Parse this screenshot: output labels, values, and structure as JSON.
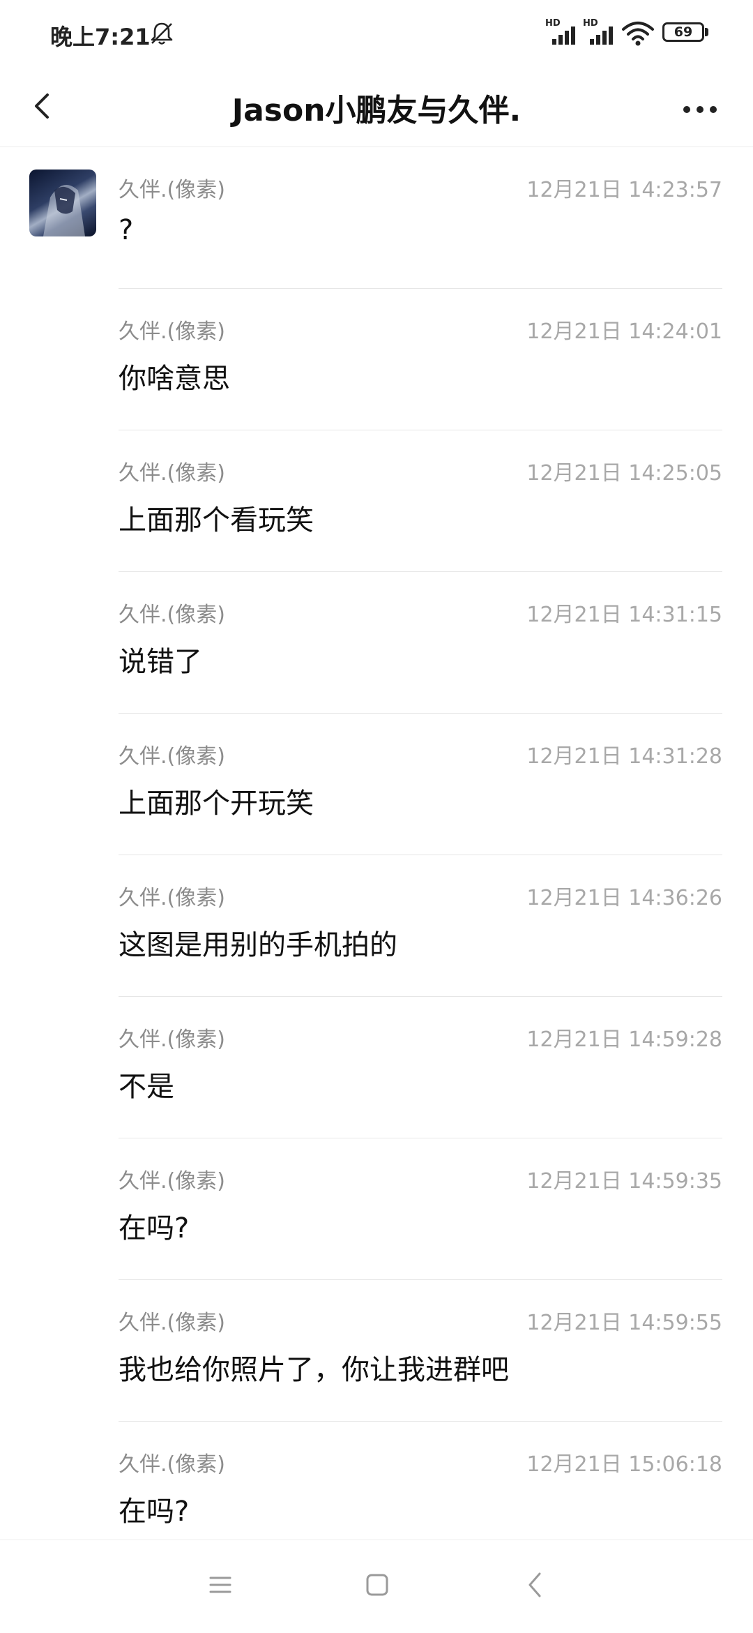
{
  "status_bar": {
    "time": "晚上7:21",
    "signal_1_label": "HD",
    "signal_2_label": "HD",
    "battery": "69",
    "icons": [
      "bell-muted-icon",
      "signal-icon",
      "signal-icon",
      "wifi-icon",
      "battery-icon"
    ]
  },
  "header": {
    "title": "Jason小鹏友与久伴.",
    "back_icon": "chevron-left-icon",
    "more_icon": "more-dots-icon"
  },
  "messages": [
    {
      "sender": "久伴.(像素)",
      "time": "12月21日 14:23:57",
      "text": "?"
    },
    {
      "sender": "久伴.(像素)",
      "time": "12月21日 14:24:01",
      "text": "你啥意思"
    },
    {
      "sender": "久伴.(像素)",
      "time": "12月21日 14:25:05",
      "text": "上面那个看玩笑"
    },
    {
      "sender": "久伴.(像素)",
      "time": "12月21日 14:31:15",
      "text": "说错了"
    },
    {
      "sender": "久伴.(像素)",
      "time": "12月21日 14:31:28",
      "text": "上面那个开玩笑"
    },
    {
      "sender": "久伴.(像素)",
      "time": "12月21日 14:36:26",
      "text": "这图是用别的手机拍的"
    },
    {
      "sender": "久伴.(像素)",
      "time": "12月21日 14:59:28",
      "text": "不是"
    },
    {
      "sender": "久伴.(像素)",
      "time": "12月21日 14:59:35",
      "text": "在吗?"
    },
    {
      "sender": "久伴.(像素)",
      "time": "12月21日 14:59:55",
      "text": "我也给你照片了，你让我进群吧"
    },
    {
      "sender": "久伴.(像素)",
      "time": "12月21日 15:06:18",
      "text": "在吗?"
    }
  ],
  "nav_bar": {
    "icons": [
      "menu-icon",
      "home-icon",
      "back-icon"
    ]
  }
}
